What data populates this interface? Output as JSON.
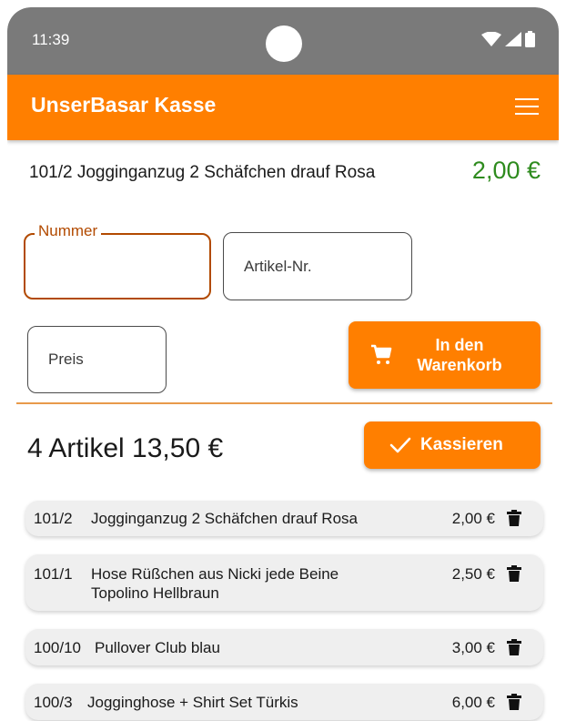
{
  "status_bar": {
    "time": "11:39"
  },
  "app_bar": {
    "title": "UnserBasar Kasse"
  },
  "last_item": {
    "description": "101/2 Jogginganzug 2 Schäfchen drauf Rosa",
    "price": "2,00 €"
  },
  "form": {
    "nummer": {
      "label": "Nummer",
      "value": ""
    },
    "artikel_nr": {
      "placeholder": "Artikel-Nr.",
      "value": ""
    },
    "preis": {
      "placeholder": "Preis",
      "value": ""
    },
    "add_to_cart_label": "In den Warenkorb"
  },
  "summary": {
    "text": "4 Artikel 13,50 €",
    "checkout_label": "Kassieren"
  },
  "cart_items": [
    {
      "nr": "101/2",
      "description": "Jogginganzug 2 Schäfchen drauf Rosa",
      "price": "2,00 €"
    },
    {
      "nr": "101/1",
      "description": "Hose Rüßchen aus Nicki jede Beine Topolino Hellbraun",
      "price": "2,50 €"
    },
    {
      "nr": "100/10",
      "description": "Pullover Club blau",
      "price": "3,00 €"
    },
    {
      "nr": "100/3",
      "description": "Jogginghose + Shirt Set Türkis",
      "price": "6,00 €"
    }
  ],
  "colors": {
    "accent": "#ff7f00",
    "price_green": "#2e8b1e",
    "focus_border": "#b24a00"
  },
  "icons": [
    "wifi-icon",
    "signal-icon",
    "battery-icon",
    "menu-icon",
    "cart-icon",
    "check-icon",
    "trash-icon"
  ]
}
